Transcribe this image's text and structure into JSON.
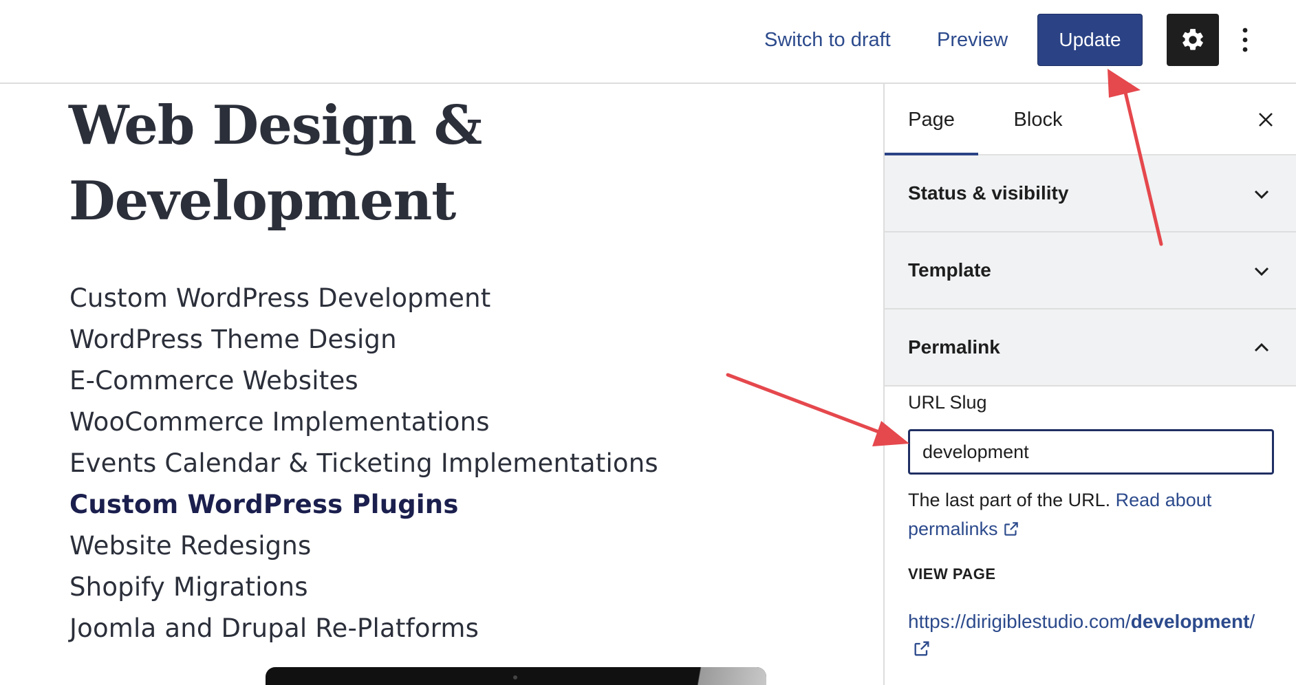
{
  "toolbar": {
    "switch_to_draft": "Switch to draft",
    "preview": "Preview",
    "update": "Update",
    "settings_icon": "gear-icon",
    "more_icon": "vertical-ellipsis-icon"
  },
  "content": {
    "title": "Web Design & Development",
    "services": [
      "Custom WordPress Development",
      "WordPress Theme Design",
      "E-Commerce Websites",
      "WooCommerce Implementations",
      "Events Calendar & Ticketing Implementations",
      "Custom WordPress Plugins",
      "Website Redesigns",
      "Shopify Migrations",
      "Joomla and Drupal Re-Platforms"
    ]
  },
  "sidebar": {
    "tabs": [
      "Page",
      "Block"
    ],
    "active_tab": "Page",
    "panels": [
      {
        "title": "Status & visibility",
        "expanded": false
      },
      {
        "title": "Template",
        "expanded": false
      },
      {
        "title": "Permalink",
        "expanded": true
      }
    ],
    "permalink": {
      "slug_label": "URL Slug",
      "slug_value": "development",
      "help_text": "The last part of the URL.",
      "help_link": "Read about permalinks",
      "view_page_label": "VIEW PAGE",
      "url_prefix": "https://dirigiblestudio.com/",
      "url_slug": "development",
      "url_suffix": "/"
    }
  },
  "colors": {
    "accent": "#2b4385",
    "link": "#2c4a8c",
    "annotation_arrow": "#e5484d",
    "panel_bg": "#f0f2f3"
  }
}
